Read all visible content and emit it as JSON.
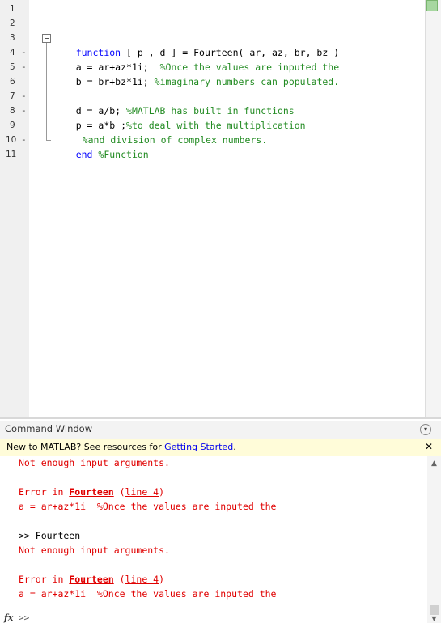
{
  "editor": {
    "line_numbers": [
      "1",
      "2",
      "3",
      "4",
      "5",
      "6",
      "7",
      "8",
      "9",
      "10",
      "11"
    ],
    "line_dashes": {
      "4": "-",
      "5": "-",
      "7": "-",
      "8": "-",
      "10": "-"
    },
    "code": {
      "l3": {
        "kw": "function",
        "rest": " [ p , d ] = Fourteen( ar, az, br, bz )"
      },
      "l4": {
        "code": "a = ar+az*1i;  ",
        "comment": "%Once the values are inputed the"
      },
      "l5_pre": "b ",
      "l5": {
        "code": "= br+bz*1i; ",
        "comment": "%imaginary numbers can populated."
      },
      "l7": {
        "code": "d = a/b; ",
        "comment": "%MATLAB has built in functions"
      },
      "l8": {
        "code": "p = a*b ;",
        "comment": "%to deal with the multiplication"
      },
      "l9": {
        "comment": "%and division of complex numbers."
      },
      "l10": {
        "kw": "end",
        "comment": " %Function"
      }
    }
  },
  "command_window": {
    "title": "Command Window",
    "menu_icon": "chevron-down-circle-icon",
    "banner": {
      "text": "New to MATLAB? See resources for ",
      "link": "Getting Started",
      "suffix": ".",
      "close": "✕"
    },
    "output": {
      "l1": "Not enough input arguments.",
      "l3_prefix": "Error in ",
      "l3_link": "Fourteen",
      "l3_mid": " (",
      "l3_link2": "line 4",
      "l3_suffix": ")",
      "l4": "a = ar+az*1i  %Once the values are inputed the",
      "l6": ">> Fourteen",
      "l7": "Not enough input arguments.",
      "l9_prefix": "Error in ",
      "l9_link": "Fourteen",
      "l9_mid": " (",
      "l9_link2": "line 4",
      "l9_suffix": ")",
      "l10": "a = ar+az*1i  %Once the values are inputed the"
    },
    "fx": "fx",
    "prompt": ">>"
  },
  "colors": {
    "keyword": "#0000ff",
    "comment": "#228b22",
    "error": "#e00000",
    "banner_bg": "#fffcd9"
  }
}
